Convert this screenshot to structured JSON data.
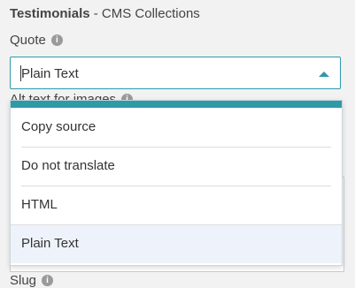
{
  "section": {
    "title_bold": "Testimonials",
    "title_rest": " - CMS Collections"
  },
  "quote_field": {
    "label": "Quote",
    "value": "Plain Text"
  },
  "background_fields": {
    "alt_text_label": "Alt text for images",
    "next_label": "Slug"
  },
  "dropdown": {
    "options": [
      {
        "label": "Copy source"
      },
      {
        "label": "Do not translate"
      },
      {
        "label": "HTML"
      },
      {
        "label": "Plain Text"
      }
    ],
    "selected": "Plain Text"
  },
  "colors": {
    "accent": "#2e9aa8",
    "selected_bg": "#eef3fb"
  }
}
